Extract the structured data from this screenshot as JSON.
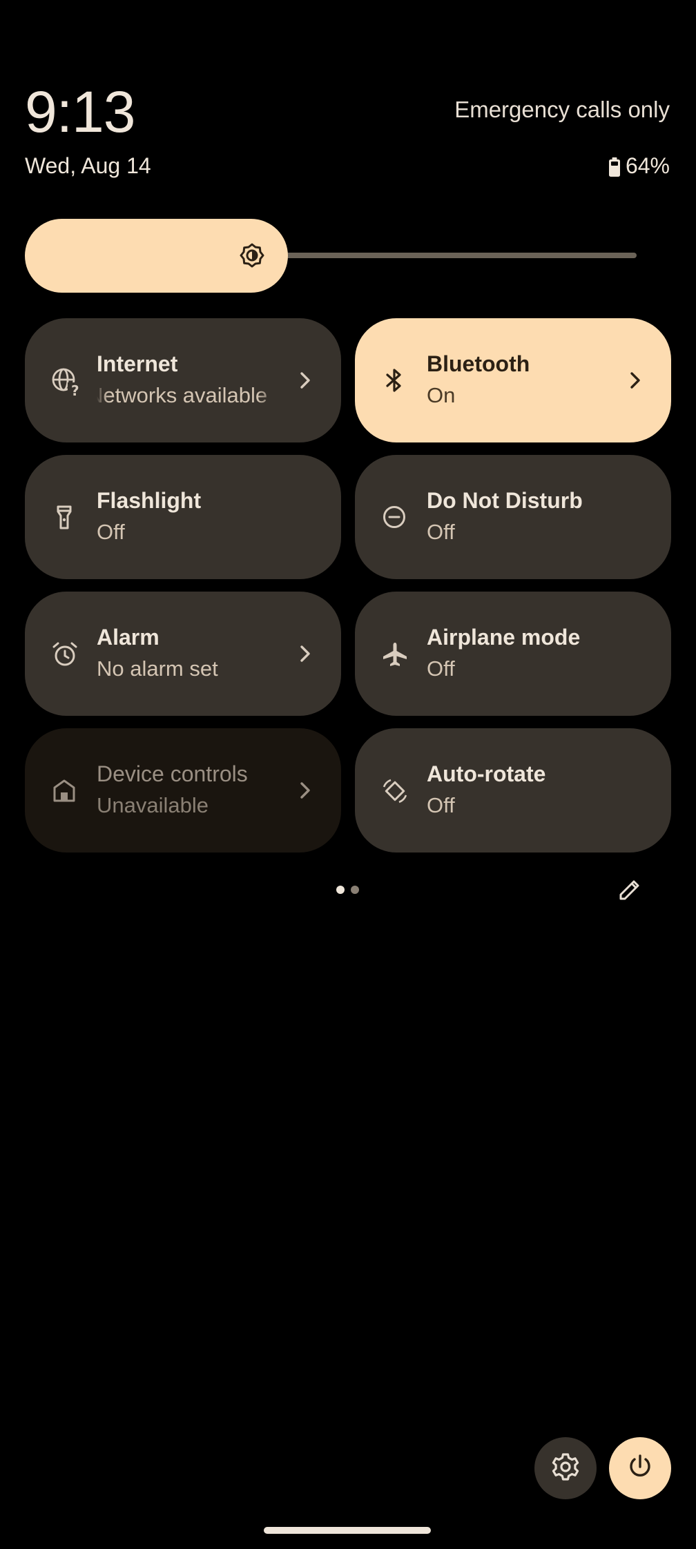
{
  "status": {
    "time": "9:13",
    "date": "Wed, Aug 14",
    "carrier": "Emergency calls only",
    "battery": "64%"
  },
  "brightness": {
    "level": 0.43
  },
  "colors": {
    "accent": "#fddcb1",
    "tile": "#37322c",
    "tile_disabled": "#1a150f",
    "background": "#000000"
  },
  "tiles": [
    {
      "label": "Internet",
      "state": "Networks available",
      "icon": "globe-question-icon",
      "active": false,
      "chevron": true
    },
    {
      "label": "Bluetooth",
      "state": "On",
      "icon": "bluetooth-icon",
      "active": true,
      "chevron": true
    },
    {
      "label": "Flashlight",
      "state": "Off",
      "icon": "flashlight-icon",
      "active": false,
      "chevron": false
    },
    {
      "label": "Do Not Disturb",
      "state": "Off",
      "icon": "do-not-disturb-icon",
      "active": false,
      "chevron": false
    },
    {
      "label": "Alarm",
      "state": "No alarm set",
      "icon": "alarm-icon",
      "active": false,
      "chevron": true
    },
    {
      "label": "Airplane mode",
      "state": "Off",
      "icon": "airplane-icon",
      "active": false,
      "chevron": false
    },
    {
      "label": "Device controls",
      "state": "Unavailable",
      "icon": "home-icon",
      "active": false,
      "chevron": true
    },
    {
      "label": "Auto-rotate",
      "state": "Off",
      "icon": "auto-rotate-icon",
      "active": false,
      "chevron": false
    }
  ],
  "pager": {
    "page": 1,
    "total": 2
  },
  "icons": {
    "edit": "pencil-icon",
    "settings": "gear-icon",
    "power": "power-icon"
  }
}
